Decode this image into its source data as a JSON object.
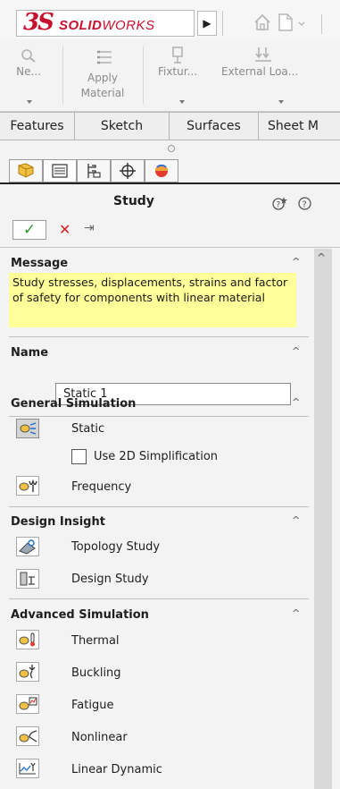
{
  "app": {
    "logo_mark": "3S",
    "logo_word_bold": "SOLID",
    "logo_word_light": "WORKS",
    "play_glyph": "▶"
  },
  "ribbon": {
    "items": [
      {
        "label_1": "Ne...",
        "label_2": "",
        "icon": "new-study-icon"
      },
      {
        "label_1": "Apply",
        "label_2": "Material",
        "icon": "apply-material-icon"
      },
      {
        "label_1": "Fixtur...",
        "label_2": "",
        "icon": "fixture-icon"
      },
      {
        "label_1": "External Loa...",
        "label_2": "",
        "icon": "external-load-icon"
      }
    ]
  },
  "tabs": [
    "Features",
    "Sketch",
    "Surfaces",
    "Sheet M"
  ],
  "property_manager": {
    "title": "Study",
    "ok_glyph": "✓",
    "cancel_glyph": "✕",
    "pin_glyph": "⇥",
    "help_glyph": "?"
  },
  "sections": {
    "message": {
      "title": "Message",
      "text": "Study stresses, displacements, strains and factor of safety  for components with linear material"
    },
    "name": {
      "title": "Name",
      "value": "Static 1"
    },
    "general": {
      "title": "General Simulation",
      "static": "Static",
      "use2d": "Use 2D Simplification",
      "frequency": "Frequency"
    },
    "design": {
      "title": "Design Insight",
      "topology": "Topology Study",
      "design_study": "Design Study"
    },
    "advanced": {
      "title": "Advanced Simulation",
      "thermal": "Thermal",
      "buckling": "Buckling",
      "fatigue": "Fatigue",
      "nonlinear": "Nonlinear",
      "linear_dynamic": "Linear Dynamic"
    }
  },
  "colors": {
    "brand": "#c8102e",
    "message_bg": "#ffff99",
    "ok_green": "#2c9a2c",
    "cancel_red": "#d32020"
  },
  "collapse_glyph": "^"
}
